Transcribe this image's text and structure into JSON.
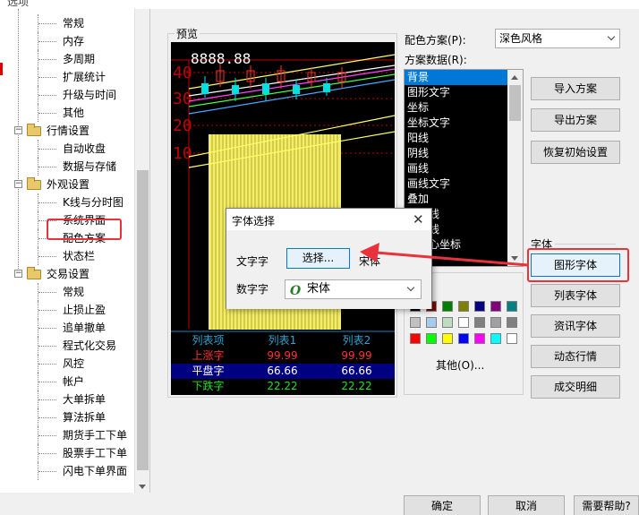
{
  "window": {
    "title": "选项"
  },
  "tree": {
    "items": [
      {
        "label": "常规",
        "type": "child"
      },
      {
        "label": "内存",
        "type": "child"
      },
      {
        "label": "多周期",
        "type": "child"
      },
      {
        "label": "扩展统计",
        "type": "child"
      },
      {
        "label": "升级与时间",
        "type": "child"
      },
      {
        "label": "其他",
        "type": "child"
      },
      {
        "label": "行情设置",
        "type": "group"
      },
      {
        "label": "自动收盘",
        "type": "child"
      },
      {
        "label": "数据与存储",
        "type": "child"
      },
      {
        "label": "外观设置",
        "type": "group"
      },
      {
        "label": "K线与分时图",
        "type": "child"
      },
      {
        "label": "系统界面",
        "type": "child"
      },
      {
        "label": "配色方案",
        "type": "child",
        "selected": true
      },
      {
        "label": "状态栏",
        "type": "child"
      },
      {
        "label": "交易设置",
        "type": "group"
      },
      {
        "label": "常规",
        "type": "child"
      },
      {
        "label": "止损止盈",
        "type": "child"
      },
      {
        "label": "追单撤单",
        "type": "child"
      },
      {
        "label": "程式化交易",
        "type": "child"
      },
      {
        "label": "风控",
        "type": "child"
      },
      {
        "label": "帐户",
        "type": "child"
      },
      {
        "label": "大单拆单",
        "type": "child"
      },
      {
        "label": "算法拆单",
        "type": "child"
      },
      {
        "label": "期货手工下单",
        "type": "child"
      },
      {
        "label": "股票手工下单",
        "type": "child"
      },
      {
        "label": "闪电下单界面",
        "type": "child"
      }
    ]
  },
  "preview": {
    "label": "预览",
    "price_readout": "8888.88",
    "axis_ticks": [
      "40",
      "30",
      "20",
      "10"
    ],
    "table": {
      "headers": [
        "列表项",
        "列表1",
        "列表2"
      ],
      "rows": [
        {
          "name": "上涨字",
          "v1": "99.99",
          "v2": "99.99"
        },
        {
          "name": "平盘字",
          "v1": "66.66",
          "v2": "66.66"
        },
        {
          "name": "下跌字",
          "v1": "22.22",
          "v2": "22.22"
        }
      ]
    }
  },
  "scheme": {
    "label": "配色方案(P):",
    "selected": "深色风格"
  },
  "scheme_data": {
    "label": "方案数据(R):",
    "items": [
      "背景",
      "图形文字",
      "坐标",
      "坐标文字",
      "阳线",
      "阴线",
      "画线",
      "画线文字",
      "叠加",
      "数据线",
      "均价线",
      "图实心坐标"
    ],
    "selected_index": 0
  },
  "palette": {
    "colors": [
      "#000000",
      "#800000",
      "#008000",
      "#808000",
      "#000080",
      "#800080",
      "#008080",
      "#c0c0c0",
      "#a6caf0",
      "#c0dcc0",
      "#ffffff",
      "#808080",
      "#a0a0a4",
      "#808080",
      "#ff0000",
      "#00ff00",
      "#ffff00",
      "#0000ff",
      "#ff00ff",
      "#00ffff",
      "#ffffff"
    ],
    "other_label": "其他(O)..."
  },
  "actions": {
    "import": "导入方案",
    "export": "导出方案",
    "restore": "恢复初始设置"
  },
  "font_group": {
    "label": "字体",
    "buttons": [
      "图形字体",
      "列表字体",
      "资讯字体",
      "动态行情",
      "成交明细"
    ]
  },
  "font_dialog": {
    "title": "字体选择",
    "text_font_label": "文字字",
    "choose_button": "选择...",
    "text_font_value": "宋体",
    "number_font_label": "数字字",
    "number_font_value": "宋体"
  },
  "footer": {
    "ok": "确定",
    "cancel": "取消",
    "help": "需要帮助?"
  }
}
